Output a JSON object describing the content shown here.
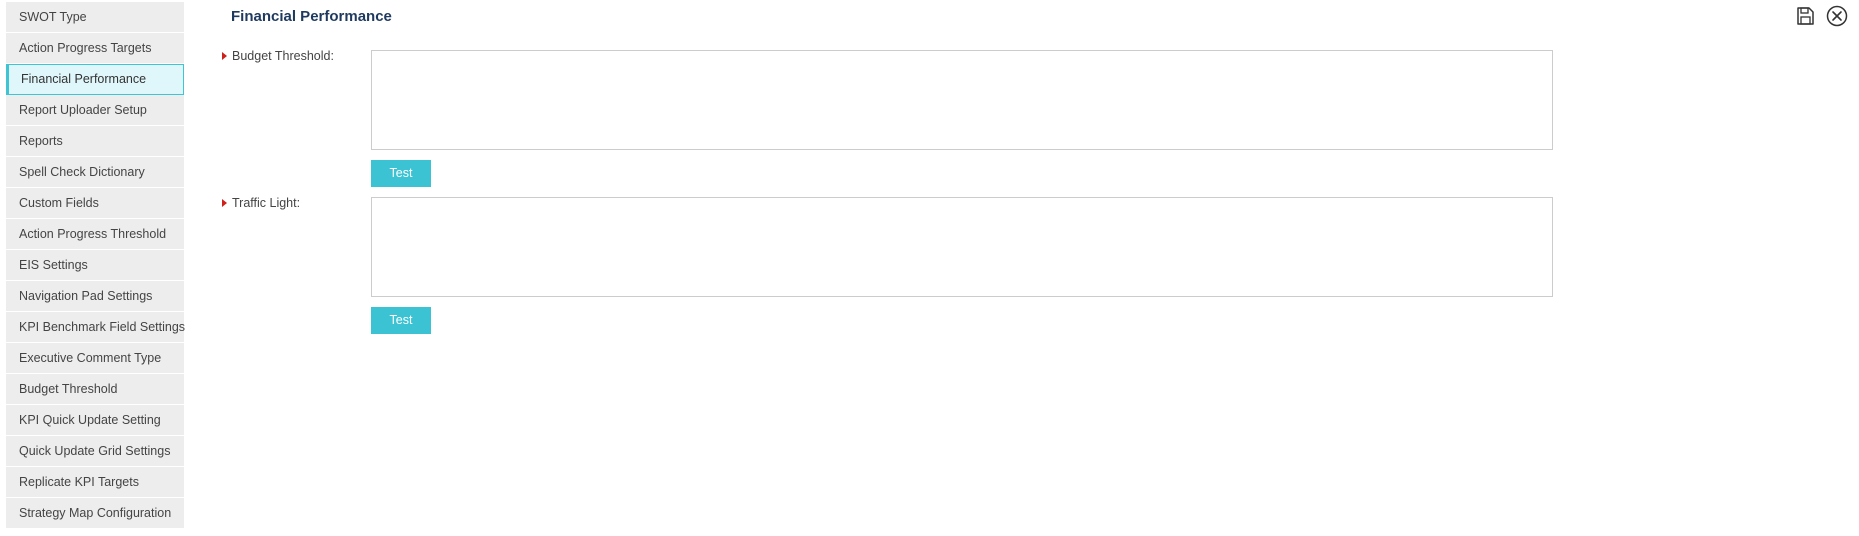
{
  "sidebar": {
    "items": [
      {
        "label": "SWOT Type"
      },
      {
        "label": "Action Progress Targets"
      },
      {
        "label": "Financial Performance"
      },
      {
        "label": "Report Uploader Setup"
      },
      {
        "label": "Reports"
      },
      {
        "label": "Spell Check Dictionary"
      },
      {
        "label": "Custom Fields"
      },
      {
        "label": "Action Progress Threshold"
      },
      {
        "label": "EIS Settings"
      },
      {
        "label": "Navigation Pad Settings"
      },
      {
        "label": "KPI Benchmark Field Settings"
      },
      {
        "label": "Executive Comment Type"
      },
      {
        "label": "Budget Threshold"
      },
      {
        "label": "KPI Quick Update Setting"
      },
      {
        "label": "Quick Update Grid Settings"
      },
      {
        "label": "Replicate KPI Targets"
      },
      {
        "label": "Strategy Map Configuration"
      }
    ],
    "active_label": "Financial Performance"
  },
  "header": {
    "title": "Financial Performance",
    "icons": {
      "save": "save-icon",
      "close": "close-circle-icon"
    }
  },
  "form": {
    "budget_threshold": {
      "label": "Budget Threshold:",
      "value": "",
      "button_label": "Test"
    },
    "traffic_light": {
      "label": "Traffic Light:",
      "value": "",
      "button_label": "Test"
    }
  },
  "colors": {
    "accent": "#3cc3d3",
    "required_marker": "#d0201b",
    "title": "#1f3a5f",
    "sidebar_bg": "#ededed",
    "sidebar_active_bg": "#dff7fa"
  }
}
